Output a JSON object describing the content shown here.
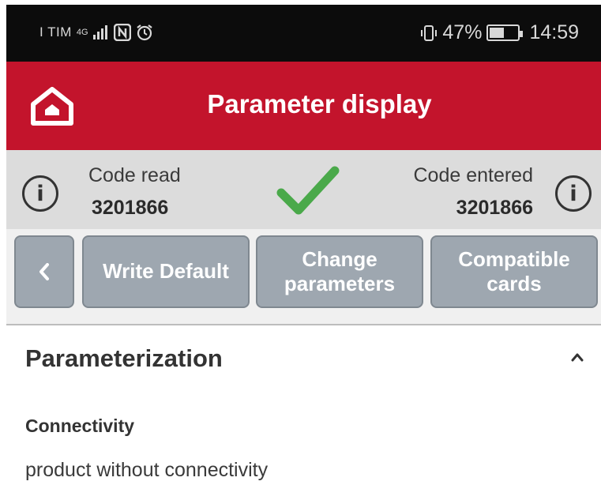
{
  "status_bar": {
    "carrier": "I TIM",
    "network": "4G",
    "battery": "47%",
    "time": "14:59"
  },
  "header": {
    "title": "Parameter display",
    "color": "#c3142c"
  },
  "code_bar": {
    "read_label": "Code read",
    "read_value": "3201866",
    "entered_label": "Code entered",
    "entered_value": "3201866",
    "info_glyph": "i",
    "match_color": "#4aa94a"
  },
  "buttons": {
    "back_glyph": "‹",
    "write_default": "Write Default",
    "change_parameters": "Change parameters",
    "compatible_cards": "Compatible cards"
  },
  "section": {
    "title": "Parameterization",
    "field_label": "Connectivity",
    "field_value": "product without connectivity"
  }
}
